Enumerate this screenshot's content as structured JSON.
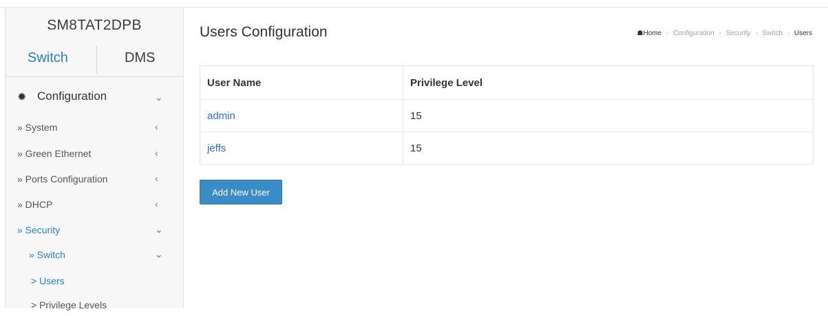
{
  "device": {
    "name": "SM8TAT2DPB"
  },
  "tabs": [
    {
      "label": "Switch",
      "active": true
    },
    {
      "label": "DMS",
      "active": false
    }
  ],
  "nav": {
    "configuration": {
      "label": "Configuration",
      "icon": "gear-icon"
    },
    "items": [
      {
        "label": "» System",
        "chevron": "‹",
        "indent": 0
      },
      {
        "label": "» Green Ethernet",
        "chevron": "‹",
        "indent": 0
      },
      {
        "label": "» Ports Configuration",
        "chevron": "‹",
        "indent": 0
      },
      {
        "label": "» DHCP",
        "chevron": "‹",
        "indent": 0
      },
      {
        "label": "» Security",
        "chevron": "⌄",
        "indent": 0,
        "active": true
      },
      {
        "label": "» Switch",
        "chevron": "⌄",
        "indent": 1,
        "active": true
      },
      {
        "label": "> Users",
        "chevron": "",
        "indent": 2,
        "active": true
      },
      {
        "label": "> Privilege Levels",
        "chevron": "",
        "indent": 2
      }
    ]
  },
  "page": {
    "title": "Users Configuration"
  },
  "breadcrumb": {
    "home": "Home",
    "items": [
      "Configuration",
      "Security",
      "Switch"
    ],
    "current": "Users"
  },
  "table": {
    "headers": [
      "User Name",
      "Privilege Level"
    ],
    "rows": [
      {
        "user": "admin",
        "level": "15"
      },
      {
        "user": "jeffs",
        "level": "15"
      }
    ]
  },
  "actions": {
    "add_user_label": "Add New User"
  },
  "colors": {
    "accent": "#2a7fc7",
    "link": "#2a6fd6",
    "button": "#3a8cc6"
  }
}
